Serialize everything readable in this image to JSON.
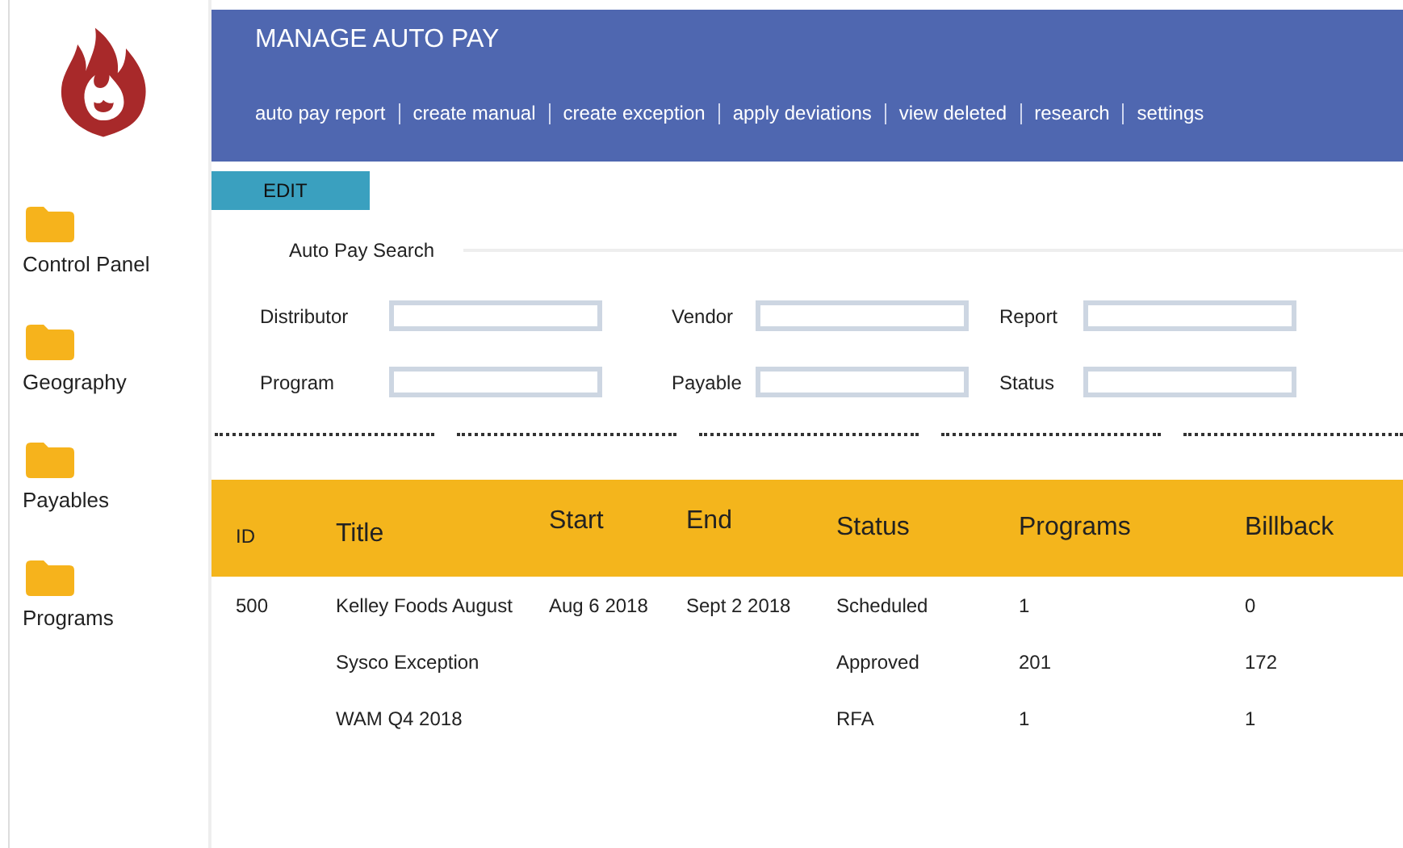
{
  "sidebar": {
    "items": [
      {
        "label": "Control Panel"
      },
      {
        "label": "Geography"
      },
      {
        "label": "Payables"
      },
      {
        "label": "Programs"
      }
    ]
  },
  "header": {
    "title": "MANAGE AUTO PAY",
    "nav": [
      "auto pay report",
      "create manual",
      "create exception",
      "apply deviations",
      "view deleted",
      "research",
      "settings"
    ]
  },
  "edit_button": "EDIT",
  "search": {
    "title": "Auto Pay Search",
    "fields": [
      {
        "label": "Distributor"
      },
      {
        "label": "Vendor"
      },
      {
        "label": "Report"
      },
      {
        "label": "Program"
      },
      {
        "label": "Payable"
      },
      {
        "label": "Status"
      }
    ]
  },
  "table": {
    "columns": [
      "ID",
      "Title",
      "Start",
      "End",
      "Status",
      "Programs",
      "Billback"
    ],
    "rows": [
      {
        "id": "500",
        "title": "Kelley Foods August",
        "start": "Aug 6 2018",
        "end": "Sept 2 2018",
        "status": "Scheduled",
        "programs": "1",
        "billback": "0"
      },
      {
        "title": "Sysco Exception",
        "status": "Approved",
        "programs": "201",
        "billback": "172"
      },
      {
        "title": "WAM Q4 2018",
        "status": "RFA",
        "programs": "1",
        "billback": "1"
      }
    ]
  }
}
